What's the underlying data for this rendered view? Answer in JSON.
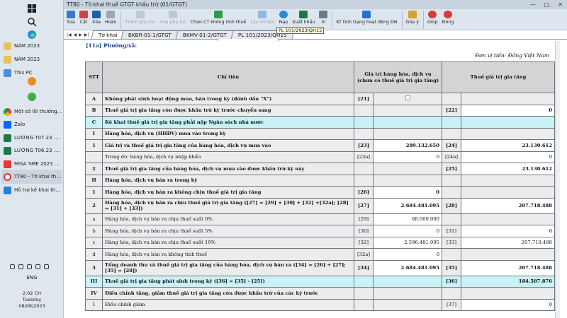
{
  "taskbar": {
    "items": [
      {
        "label": "NĂM 2023",
        "icon": "folder-icon"
      },
      {
        "label": "NĂM 2023",
        "icon": "folder-icon"
      },
      {
        "label": "This PC",
        "icon": "computer-icon"
      },
      {
        "label": "Một số lỗi thường gặ...",
        "icon": "chrome-icon"
      },
      {
        "label": "Zalo",
        "icon": "zalo-icon"
      },
      {
        "label": "LƯƠNG T07.23 .xlsx -...",
        "icon": "excel-icon"
      },
      {
        "label": "LƯƠNG T06.23 .xlsx -...",
        "icon": "excel-icon"
      },
      {
        "label": "MISA SME 2023 R13 ...",
        "icon": "misa-icon"
      },
      {
        "label": "TT80 - Tờ khai thuế G...",
        "icon": "tt80-icon"
      },
      {
        "label": "Hỗ trợ kê khai thuế -...",
        "icon": "help-icon"
      }
    ],
    "language": "ENG",
    "time": "2:02 CH",
    "day": "Tuesday",
    "date": "08/08/2023"
  },
  "window": {
    "title": "TT80 - Tờ khai thuế GTGT khấu trừ (01/GTGT)",
    "minimize": "—",
    "maximize": "□",
    "close": "✕"
  },
  "toolbar": {
    "items": [
      {
        "label": "Sửa",
        "icon": "edit-icon",
        "enabled": true
      },
      {
        "label": "Cắt",
        "icon": "cut-icon",
        "enabled": true
      },
      {
        "label": "Xóa",
        "icon": "save-icon",
        "enabled": true
      },
      {
        "label": "Hoãn",
        "icon": "undo-icon",
        "enabled": true
      },
      {
        "label": "Thêm phụ lục",
        "icon": "add-appendix-icon",
        "enabled": false
      },
      {
        "label": "Xóa phụ lục",
        "icon": "delete-appendix-icon",
        "enabled": false
      },
      {
        "label": "Chọn CT không tính thuế",
        "icon": "select-document-icon",
        "enabled": true
      },
      {
        "label": "Lấy dữ liệu",
        "icon": "fetch-data-icon",
        "enabled": false
      },
      {
        "label": "Nạp",
        "icon": "reload-icon",
        "enabled": true
      },
      {
        "label": "Xuất khẩu",
        "icon": "export-excel-icon",
        "enabled": true
      },
      {
        "label": "In",
        "icon": "print-icon",
        "enabled": true
      },
      {
        "label": "KT tình trạng hoạt động DN",
        "icon": "check-status-icon",
        "enabled": true
      },
      {
        "label": "Góp ý",
        "icon": "feedback-icon",
        "enabled": true
      },
      {
        "label": "Giúp",
        "icon": "help-icon",
        "enabled": true
      },
      {
        "label": "Đóng",
        "icon": "close-icon",
        "enabled": true
      }
    ]
  },
  "tabs": {
    "items": [
      "Tờ khai",
      "BKBR-01-1/GTGT",
      "BKMV-01-2/GTGT",
      "PL 101/2023/QH15"
    ],
    "active": 0,
    "tooltip": "PL 101/2023/QH15"
  },
  "form": {
    "ward_label": "[11a] Phường/xã:",
    "currency_note": "Đơn vị tiền: Đồng Việt Nam",
    "headers": {
      "stt": "STT",
      "indicator": "Chỉ tiêu",
      "goods_value": "Giá trị hàng hóa, dịch vụ (chưa có thuế giá trị gia tăng)",
      "vat": "Thuế giá trị gia tăng"
    },
    "rows": [
      {
        "stt": "A",
        "label": "Không phát sinh hoạt động mua, bán trong kỳ (đánh dấu \"X\")",
        "c1": "[21]",
        "v1": "",
        "c2": "",
        "v2": "",
        "bold": true,
        "checkbox": true
      },
      {
        "stt": "B",
        "label": "Thuế giá trị gia tăng còn được khấu trừ kỳ trước chuyển sang",
        "c1": "",
        "v1": "",
        "c2": "[22]",
        "v2": "0",
        "bold": true
      },
      {
        "stt": "C",
        "label": "Kê khai thuế giá trị gia tăng phải nộp Ngân sách nhà nước",
        "c1": "",
        "v1": "",
        "c2": "",
        "v2": "",
        "bold": true,
        "section": true
      },
      {
        "stt": "I",
        "label": "Hàng hóa, dịch vụ (HHDV) mua vào trong kỳ",
        "c1": "",
        "v1": "",
        "c2": "",
        "v2": "",
        "bold": true
      },
      {
        "stt": "1",
        "label": "Giá trị và thuế giá trị gia tăng của hàng hóa, dịch vụ mua vào",
        "c1": "[23]",
        "v1": "289.132.650",
        "c2": "[24]",
        "v2": "23.130.612",
        "bold": true
      },
      {
        "stt": "",
        "label": "Trong đó: hàng hóa, dịch vụ nhập khẩu",
        "c1": "[23a]",
        "v1": "0",
        "c2": "[24a]",
        "v2": "0",
        "bold": false,
        "white": true
      },
      {
        "stt": "2",
        "label": "Thuế giá trị gia tăng của hàng hóa, dịch vụ mua vào được khấu trừ kỳ này",
        "c1": "",
        "v1": "",
        "c2": "[25]",
        "v2": "23.130.612",
        "bold": true
      },
      {
        "stt": "II",
        "label": "Hàng hóa, dịch vụ bán ra trong kỳ",
        "c1": "",
        "v1": "",
        "c2": "",
        "v2": "",
        "bold": true
      },
      {
        "stt": "1",
        "label": "Hàng hóa, dịch vụ bán ra không chịu thuế giá trị gia tăng",
        "c1": "[26]",
        "v1": "0",
        "c2": "",
        "v2": "",
        "bold": true
      },
      {
        "stt": "2",
        "label": "Hàng hóa, dịch vụ bán ra chịu thuế giá trị gia tăng ([27] = [29] + [30] + [32] +[32a]; [28] = [31] + [33])",
        "c1": "[27]",
        "v1": "2.684.481.095",
        "c2": "[28]",
        "v2": "207.718.488",
        "bold": true,
        "tall": true
      },
      {
        "stt": "a",
        "label": "Hàng hóa, dịch vụ bán ra chịu thuế suất 0%",
        "c1": "[29]",
        "v1": "88.000.000",
        "c2": "",
        "v2": "",
        "bold": false
      },
      {
        "stt": "b",
        "label": "Hàng hóa, dịch vụ bán ra chịu thuế suất 5%",
        "c1": "[30]",
        "v1": "0",
        "c2": "[31]",
        "v2": "0",
        "bold": false
      },
      {
        "stt": "c",
        "label": "Hàng hóa, dịch vụ bán ra chịu thuế suất 10%",
        "c1": "[32]",
        "v1": "2.596.481.095",
        "c2": "[33]",
        "v2": "207.718.488",
        "bold": false
      },
      {
        "stt": "d",
        "label": "Hàng hóa, dịch vụ bán ra không tính thuế",
        "c1": "[32a]",
        "v1": "0",
        "c2": "",
        "v2": "",
        "bold": false,
        "white": true
      },
      {
        "stt": "3",
        "label": "Tổng doanh thu và thuế giá trị gia tăng của hàng hóa, dịch vụ bán ra ([34] = [26] + [27]; [35] = [28])",
        "c1": "[34]",
        "v1": "2.684.481.095",
        "c2": "[35]",
        "v2": "207.718.488",
        "bold": true,
        "tall": true
      },
      {
        "stt": "III",
        "label": "Thuế giá trị gia tăng phát sinh trong kỳ ([36] = [35] - [25])",
        "c1": "",
        "v1": "",
        "c2": "[36]",
        "v2": "184.587.876",
        "bold": true,
        "section": true
      },
      {
        "stt": "IV",
        "label": "Điều chỉnh tăng, giảm thuế giá trị gia tăng còn được khấu trừ của các kỳ trước",
        "c1": "",
        "v1": "",
        "c2": "",
        "v2": "",
        "bold": true
      },
      {
        "stt": "1",
        "label": "Điều chỉnh giảm",
        "c1": "",
        "v1": "",
        "c2": "[37]",
        "v2": "0",
        "bold": false
      }
    ]
  }
}
